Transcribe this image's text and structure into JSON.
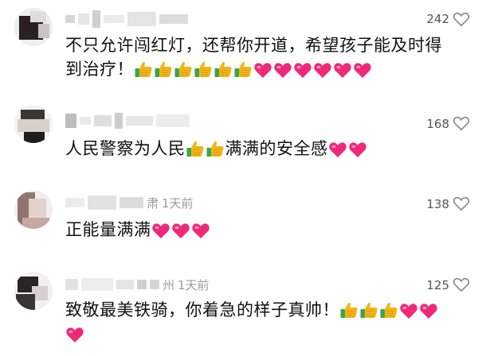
{
  "comments": [
    {
      "username": "",
      "time_text": "",
      "likes": "242",
      "line1": "不只允许闯红灯，还帮你开道，希望孩子能及时得",
      "line2": "到治疗！",
      "emoji_line2": [
        "thumbs",
        "thumbs",
        "thumbs",
        "thumbs",
        "thumbs",
        "thumbs",
        "heart",
        "heart",
        "heart",
        "heart",
        "heart",
        "heart"
      ]
    },
    {
      "username": "",
      "time_text": "",
      "likes": "168",
      "line1a": "人民警察为人民",
      "line1b": "满满的安全感"
    },
    {
      "username_suffix": "肃",
      "time_text": "1天前",
      "likes": "138",
      "line1": "正能量满满"
    },
    {
      "username_suffix": "州",
      "time_text": "1天前",
      "likes": "125",
      "line1": "致敬最美铁骑，你着急的样子真帅！"
    }
  ],
  "colors": {
    "heart_emoji": "#f0287a",
    "thumbs_emoji": "#f2b418",
    "cuff": "#3aa64a"
  },
  "icons": {
    "like": "heart-outline-icon",
    "thumbs": "thumbs-up-emoji",
    "heart": "red-heart-emoji"
  }
}
